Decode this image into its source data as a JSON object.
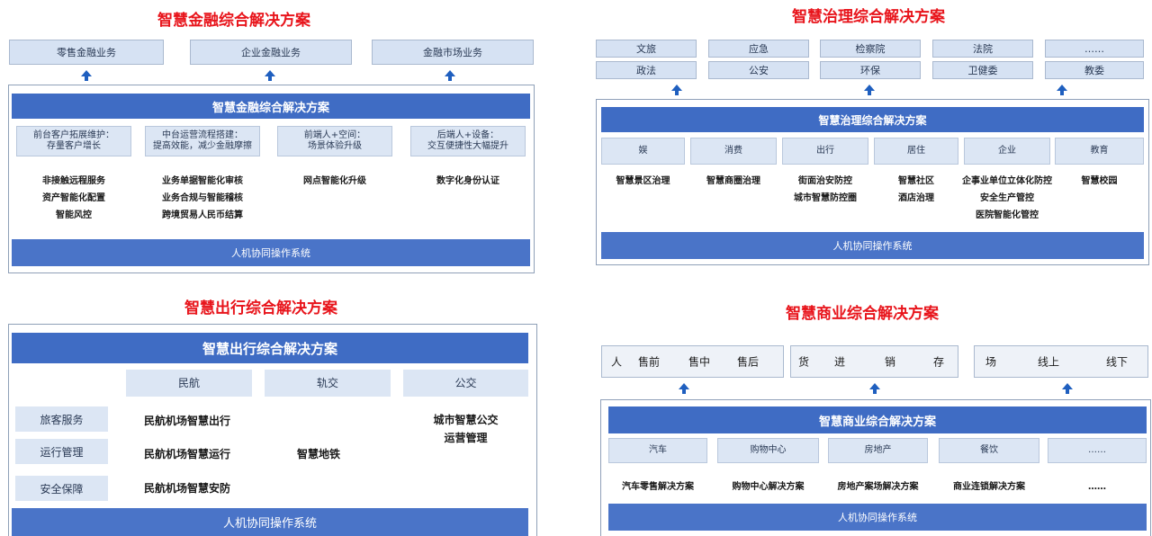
{
  "finance": {
    "title": "智慧金融综合解决方案",
    "top": [
      "零售金融业务",
      "企业金融业务",
      "金融市场业务"
    ],
    "bar": "智慧金融综合解决方案",
    "cats": [
      "前台客户拓展维护：\n存量客户增长",
      "中台运营流程搭建：\n提高效能，减少金融摩擦",
      "前端人+空间：\n场景体验升级",
      "后端人+设备：\n交互便捷性大幅提升"
    ],
    "items": [
      [
        "非接触远程服务",
        "资产智能化配置",
        "智能风控"
      ],
      [
        "业务单据智能化审核",
        "业务合规与智能稽核",
        "跨境贸易人民币结算"
      ],
      [
        "网点智能化升级"
      ],
      [
        "数字化身份认证"
      ]
    ],
    "footer": "人机协同操作系统"
  },
  "governance": {
    "title": "智慧治理综合解决方案",
    "top_row1": [
      "文旅",
      "应急",
      "检察院",
      "法院",
      "……"
    ],
    "top_row2": [
      "政法",
      "公安",
      "环保",
      "卫健委",
      "教委"
    ],
    "bar": "智慧治理综合解决方案",
    "cats": [
      "娱",
      "消费",
      "出行",
      "居住",
      "企业",
      "教育"
    ],
    "items": [
      [
        "智慧景区治理"
      ],
      [
        "智慧商圈治理"
      ],
      [
        "街面治安防控",
        "城市智慧防控圈"
      ],
      [
        "智慧社区",
        "酒店治理"
      ],
      [
        "企事业单位立体化防控",
        "安全生产管控",
        "医院智能化管控"
      ],
      [
        "智慧校园"
      ]
    ],
    "footer": "人机协同操作系统"
  },
  "mobility": {
    "title": "智慧出行综合解决方案",
    "bar": "智慧出行综合解决方案",
    "cols": [
      "民航",
      "轨交",
      "公交"
    ],
    "rows": [
      "旅客服务",
      "运行管理",
      "安全保障"
    ],
    "civil": [
      "民航机场智慧出行",
      "民航机场智慧运行",
      "民航机场智慧安防"
    ],
    "metro": "智慧地铁",
    "bus": [
      "城市智慧公交",
      "运营管理"
    ],
    "footer": "人机协同操作系统"
  },
  "commerce": {
    "title": "智慧商业综合解决方案",
    "seg1": [
      "人",
      "售前",
      "售中",
      "售后"
    ],
    "seg2": [
      "货",
      "进",
      "销",
      "存"
    ],
    "seg3": [
      "场",
      "线上",
      "线下"
    ],
    "bar": "智慧商业综合解决方案",
    "cats": [
      "汽车",
      "购物中心",
      "房地产",
      "餐饮",
      "……"
    ],
    "items": [
      "汽车零售解决方案",
      "购物中心解决方案",
      "房地产案场解决方案",
      "商业连锁解决方案",
      "……"
    ],
    "footer": "人机协同操作系统"
  }
}
